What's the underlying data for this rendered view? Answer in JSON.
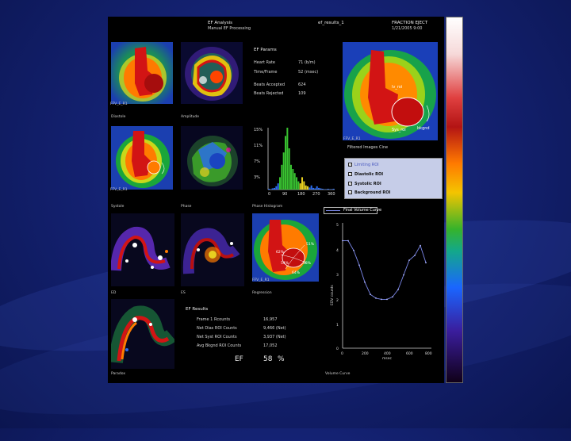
{
  "header": {
    "title": "EF Analysis",
    "subtitle": "Manual EF Processing",
    "file": "ef_results_1",
    "app": "FRACTION EJECT",
    "datetime": "1/21/2005 9:00"
  },
  "params": {
    "heading": "EF Params",
    "rows": [
      {
        "label": "Heart Rate",
        "value": "71 (b/m)"
      },
      {
        "label": "Time/Frame",
        "value": "52 (msec)"
      },
      {
        "label": "Beats Accepted",
        "value": "624"
      },
      {
        "label": "Beats Rejected",
        "value": "109"
      }
    ]
  },
  "panels": {
    "diastole": "Diastole",
    "amplitude": "Amplitude",
    "systole": "Systole",
    "phase": "Phase",
    "phase_histogram": "Phase Histogram",
    "ed": "ED",
    "es": "ES",
    "regression": "Regression",
    "paradox": "Paradox",
    "volume_curve": "Volume Curve",
    "roi_tag": "FFV_E_R1"
  },
  "roi_labels": {
    "lv_roi": "lv_roi",
    "bkgnd": "bkgnd",
    "sys_roi": "Sys_roi"
  },
  "region_values": [
    "51%",
    "62%",
    "58%",
    "54%",
    "64%"
  ],
  "filter": {
    "title": "Filtered Images Cine",
    "items": [
      {
        "label": "Limiting ROI",
        "checked": true
      },
      {
        "label": "Diastolic ROI",
        "checked": true
      },
      {
        "label": "Systolic ROI",
        "checked": true
      },
      {
        "label": "Background ROI",
        "checked": true
      }
    ]
  },
  "histogram": {
    "y_ticks": [
      "15%",
      "11%",
      "7%",
      "3%"
    ],
    "x_ticks": [
      "0",
      "90",
      "180",
      "270",
      "360"
    ]
  },
  "volume_curve": {
    "title": "Final Volume Curve",
    "ylabel": "EDV counts",
    "xlabel": "msec",
    "y_ticks": [
      "5",
      "4",
      "3",
      "2",
      "1",
      "0"
    ],
    "x_ticks": [
      "0",
      "200",
      "400",
      "600",
      "800"
    ]
  },
  "results": {
    "heading": "EF Results",
    "rows": [
      {
        "label": "Frame 1 Rcounts",
        "value": "16,957"
      },
      {
        "label": "Net Dias ROI Counts",
        "value": "9,466 (Net)"
      },
      {
        "label": "Net Syst ROI Counts",
        "value": "3,937 (Net)"
      },
      {
        "label": "Avg Bkgnd ROI Counts",
        "value": "17,052"
      }
    ],
    "ef_label": "EF",
    "ef_value": "58",
    "ef_unit": "%"
  },
  "chart_data": [
    {
      "type": "bar",
      "title": "",
      "categories": [
        "0",
        "10",
        "20",
        "30",
        "40",
        "50",
        "60",
        "70",
        "80",
        "90",
        "100",
        "110",
        "120",
        "130",
        "140",
        "150",
        "160",
        "170",
        "180",
        "190",
        "200",
        "210",
        "220",
        "230",
        "240",
        "250",
        "260",
        "270",
        "280",
        "290",
        "300",
        "310",
        "320",
        "330",
        "340",
        "350"
      ],
      "values": [
        0.2,
        0.1,
        0.3,
        0.4,
        0.8,
        1.5,
        3,
        6,
        9,
        13,
        15,
        10,
        6,
        5,
        4,
        3,
        2,
        1.5,
        3,
        2,
        1,
        0.8,
        0.5,
        1,
        0.4,
        0.3,
        0.8,
        0.4,
        0.3,
        0.2,
        0.1,
        0.1,
        0.2,
        0.1,
        0.1,
        0.2
      ],
      "ylim": [
        0,
        15
      ],
      "xlabel": "",
      "ylabel": ""
    },
    {
      "type": "line",
      "title": "Final Volume Curve",
      "x": [
        0,
        50,
        100,
        150,
        200,
        250,
        300,
        350,
        400,
        450,
        500,
        550,
        600,
        650,
        700,
        750
      ],
      "y": [
        4.4,
        4.4,
        4.0,
        3.4,
        2.7,
        2.2,
        2.05,
        2.0,
        2.0,
        2.1,
        2.4,
        3.0,
        3.6,
        3.8,
        4.2,
        3.5
      ],
      "xlim": [
        0,
        800
      ],
      "ylim": [
        0,
        5
      ],
      "xlabel": "msec",
      "ylabel": "EDV counts"
    }
  ]
}
